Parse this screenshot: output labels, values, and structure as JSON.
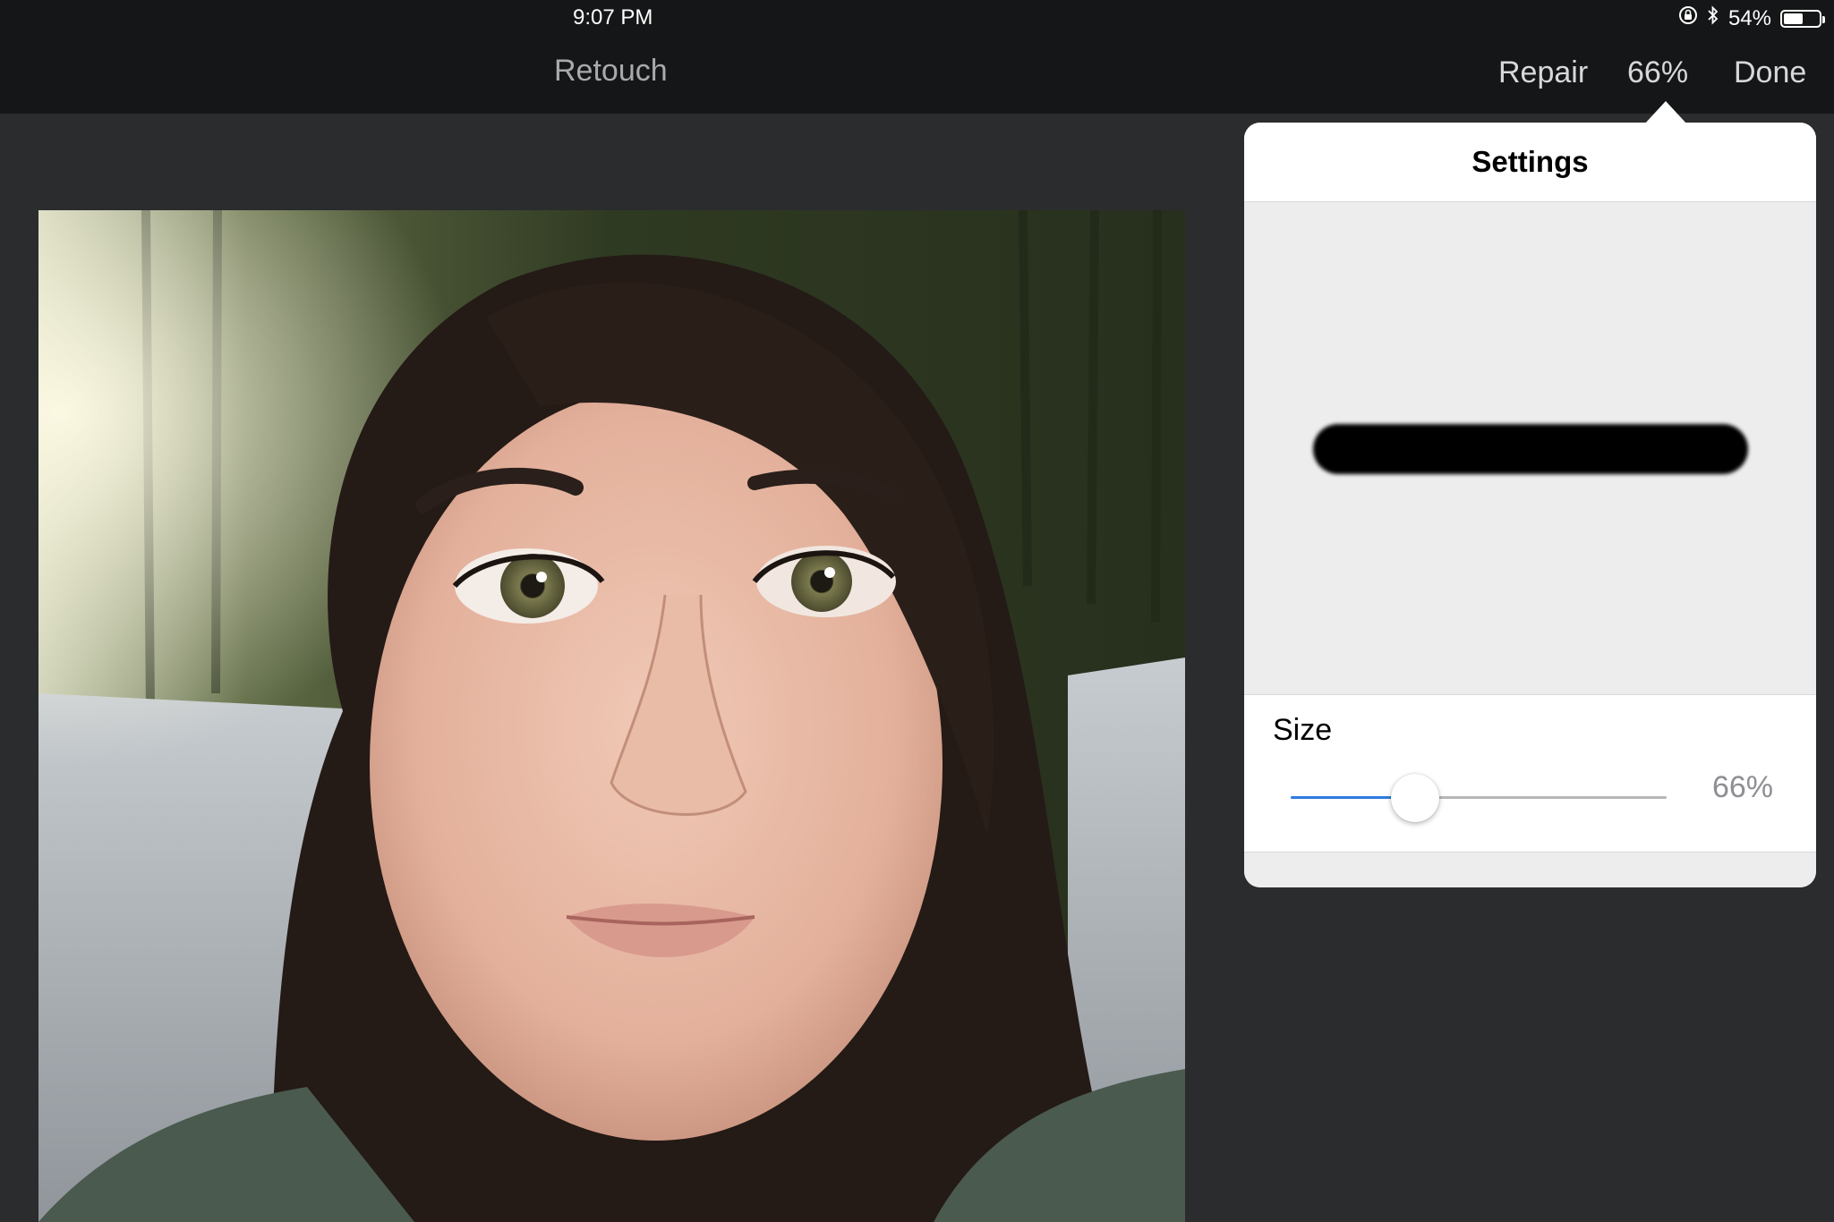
{
  "status_bar": {
    "time": "9:07 PM",
    "battery_text": "54%",
    "battery_level": 0.54,
    "icons": [
      "orientation-lock-icon",
      "bluetooth-icon",
      "battery-icon"
    ]
  },
  "nav": {
    "title": "Retouch",
    "repair_label": "Repair",
    "zoom_label": "66%",
    "done_label": "Done"
  },
  "settings": {
    "title": "Settings",
    "size_label": "Size",
    "size_value": "66%",
    "size_level": 0.33,
    "accent_color": "#2f7be0"
  }
}
